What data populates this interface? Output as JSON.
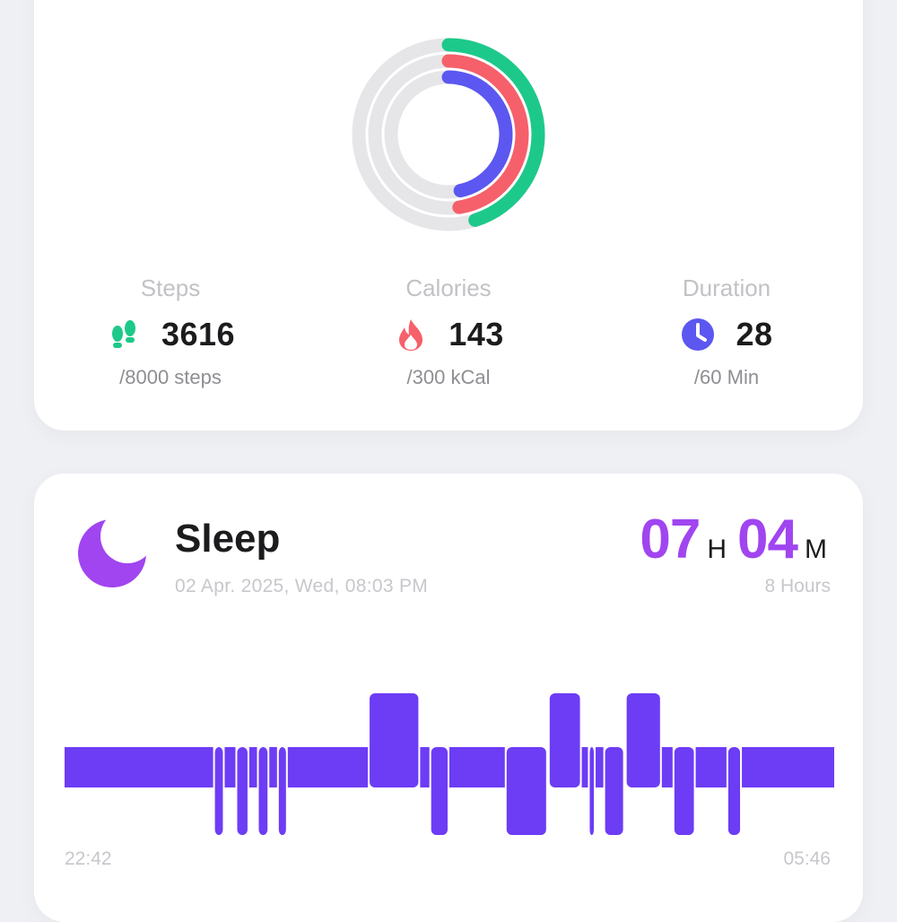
{
  "activity": {
    "rings": {
      "steps_fraction": 0.452,
      "calories_fraction": 0.477,
      "duration_fraction": 0.467,
      "colors": {
        "steps": "#1dc98a",
        "calories": "#f6606a",
        "duration": "#5b57f0",
        "track": "#e6e6e8"
      }
    },
    "steps": {
      "label": "Steps",
      "value": "3616",
      "goal": "/8000 steps",
      "icon": "footsteps-icon"
    },
    "calories": {
      "label": "Calories",
      "value": "143",
      "goal": "/300 kCal",
      "icon": "flame-icon"
    },
    "duration": {
      "label": "Duration",
      "value": "28",
      "goal": "/60 Min",
      "icon": "clock-icon"
    }
  },
  "sleep": {
    "title": "Sleep",
    "date": "02 Apr. 2025, Wed, 08:03 PM",
    "hours_value": "07",
    "hours_unit": "H",
    "minutes_value": "04",
    "minutes_unit": "M",
    "goal": "8 Hours",
    "start_time": "22:42",
    "end_time": "05:46",
    "icon": "moon-icon",
    "accent": "#a045f0",
    "stage_colors": {
      "awake": "#ff8c55",
      "light": "#c24ee8",
      "deep": "#6d3cf5"
    },
    "stages": [
      [
        "light",
        0.0,
        0.193
      ],
      [
        "deep",
        0.193,
        0.208
      ],
      [
        "light",
        0.208,
        0.222
      ],
      [
        "deep",
        0.222,
        0.24
      ],
      [
        "light",
        0.24,
        0.25
      ],
      [
        "deep",
        0.25,
        0.266
      ],
      [
        "light",
        0.266,
        0.276
      ],
      [
        "deep",
        0.276,
        0.29
      ],
      [
        "light",
        0.29,
        0.394
      ],
      [
        "awake",
        0.394,
        0.462
      ],
      [
        "light",
        0.462,
        0.474
      ],
      [
        "deep",
        0.474,
        0.5
      ],
      [
        "light",
        0.5,
        0.572
      ],
      [
        "deep",
        0.572,
        0.628
      ],
      [
        "awake",
        0.628,
        0.672
      ],
      [
        "light",
        0.672,
        0.68
      ],
      [
        "deep",
        0.68,
        0.69
      ],
      [
        "light",
        0.69,
        0.7
      ],
      [
        "deep",
        0.7,
        0.728
      ],
      [
        "awake",
        0.728,
        0.776
      ],
      [
        "light",
        0.776,
        0.79
      ],
      [
        "deep",
        0.79,
        0.82
      ],
      [
        "light",
        0.82,
        0.86
      ],
      [
        "deep",
        0.86,
        0.88
      ],
      [
        "light",
        0.88,
        1.0
      ]
    ]
  }
}
